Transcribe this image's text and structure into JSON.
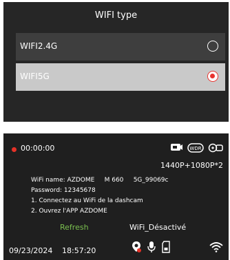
{
  "wifi_type": {
    "title": "WIFI type",
    "options": [
      {
        "label": "WIFI2.4G",
        "selected": false
      },
      {
        "label": "WIFI5G",
        "selected": true
      }
    ],
    "accent_color": "#e8342f"
  },
  "camera_screen": {
    "rec_time": "00:00:00",
    "resolution": "1440P+1080P*2",
    "status_icons": [
      "camera-switch-icon",
      "wdr-icon",
      "gsensor-icon"
    ],
    "info": {
      "wifi_name": "WiFi name: AZDOME     M 660     5G_99069c",
      "password": "Password: 12345678",
      "step1": "1. Connectez au WiFi de la dashcam",
      "step2": "2. Ouvrez l'APP AZDOME"
    },
    "refresh_label": "Refresh",
    "wifi_state": "WiFi_Désactivé",
    "date": "09/23/2024",
    "time": "18:57:20",
    "bottom_icons": [
      "gps-icon",
      "microphone-icon",
      "sd-card-icon",
      "wifi-signal-icon"
    ],
    "refresh_color": "#7bc04f"
  }
}
